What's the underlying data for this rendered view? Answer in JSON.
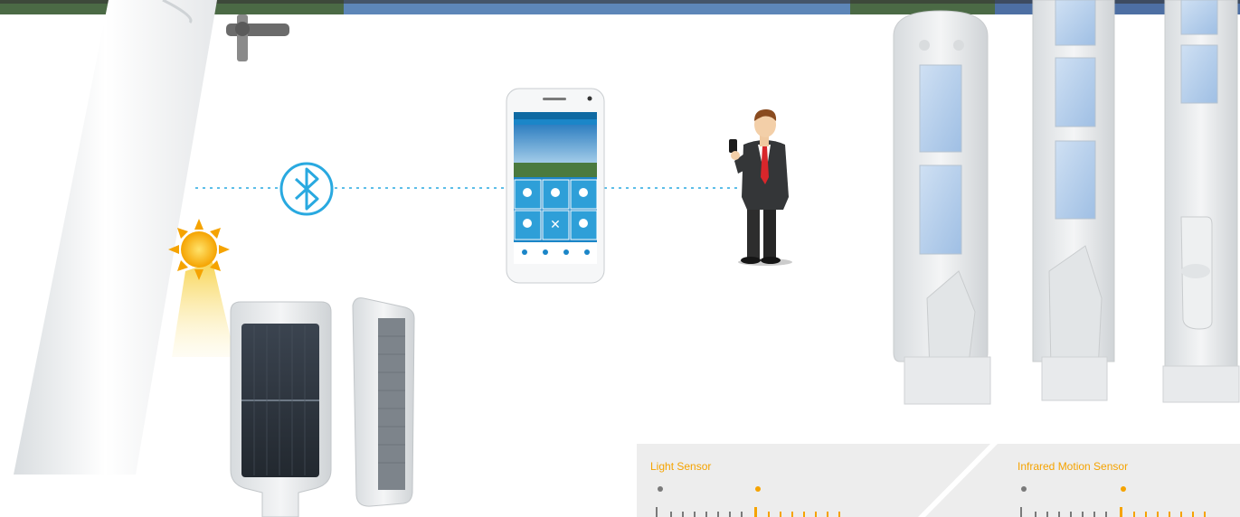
{
  "colors": {
    "connection_line": "#29a9e0",
    "sensor_accent": "#f5a300",
    "sensor_panel": "#ededed",
    "sensor_idle": "#7a7a7a"
  },
  "icons": [
    "bluetooth-icon",
    "sun-icon",
    "smartphone-icon",
    "person-icon"
  ],
  "sensor_panels": {
    "light_sensor": {
      "title": "Light Sensor"
    },
    "motion_sensor": {
      "title": "Infrared Motion Sensor"
    }
  }
}
